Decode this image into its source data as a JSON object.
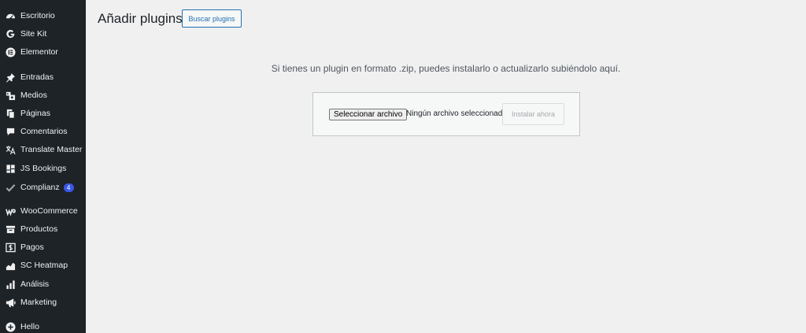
{
  "sidebar": {
    "items": [
      {
        "label": "Escritorio",
        "icon": "dashboard-icon"
      },
      {
        "label": "Site Kit",
        "icon": "google-g-icon"
      },
      {
        "label": "Elementor",
        "icon": "elementor-icon"
      },
      {
        "label": "Entradas",
        "icon": "pin-icon"
      },
      {
        "label": "Medios",
        "icon": "media-icon"
      },
      {
        "label": "Páginas",
        "icon": "pages-icon"
      },
      {
        "label": "Comentarios",
        "icon": "comment-icon"
      },
      {
        "label": "Translate Master",
        "icon": "translate-icon"
      },
      {
        "label": "JS Bookings",
        "icon": "grid-icon"
      },
      {
        "label": "Complianz",
        "icon": "checkmark-icon",
        "badge": "4"
      },
      {
        "label": "WooCommerce",
        "icon": "woocommerce-icon"
      },
      {
        "label": "Productos",
        "icon": "archive-box-icon"
      },
      {
        "label": "Pagos",
        "icon": "dollar-icon"
      },
      {
        "label": "SC Heatmap",
        "icon": "area-chart-icon"
      },
      {
        "label": "Análisis",
        "icon": "bar-chart-icon"
      },
      {
        "label": "Marketing",
        "icon": "megaphone-icon"
      },
      {
        "label": "Hello",
        "icon": "plus-circle-icon"
      }
    ]
  },
  "header": {
    "title": "Añadir plugins",
    "browse_label": "Buscar plugins"
  },
  "upload": {
    "help_text": "Si tienes un plugin en formato .zip, puedes instalarlo o actualizarlo subiéndolo aquí.",
    "choose_label": "Seleccionar archivo",
    "no_file_label": "Ningún archivo seleccionado",
    "install_label": "Instalar ahora"
  },
  "colors": {
    "sidebar_bg": "#1d2327",
    "accent": "#2271b1",
    "badge": "#3858e9"
  }
}
